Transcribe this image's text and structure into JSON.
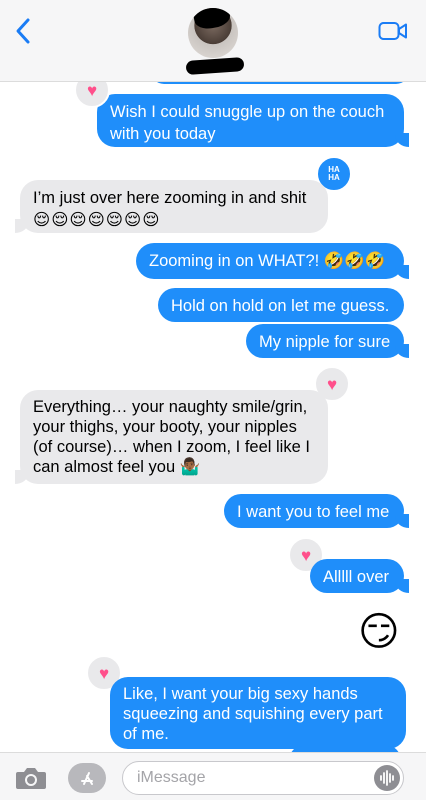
{
  "header": {
    "contact_name": ""
  },
  "messages": [
    {
      "id": "m1",
      "side": "out",
      "text_line1": "Wish I could snuggle up on the couch",
      "text_line2": "with you today",
      "reaction": "heart"
    },
    {
      "id": "m2",
      "side": "in",
      "text_line1": "I’m just over here zooming in and shit",
      "text_line2": "😌😌😌😌😌😌😌",
      "reaction": "haha"
    },
    {
      "id": "m3",
      "side": "out",
      "text": "Zooming in on WHAT?! 🤣🤣🤣"
    },
    {
      "id": "m4",
      "side": "out",
      "text": "Hold on hold on let me guess."
    },
    {
      "id": "m5",
      "side": "out",
      "text": "My nipple for sure",
      "reaction": "heart"
    },
    {
      "id": "m6",
      "side": "in",
      "lines": [
        "Everything… your naughty smile/grin,",
        "your thighs, your booty, your nipples",
        "(of course)… when I zoom, I feel like I",
        "can almost feel you 🤷🏾‍♂️"
      ]
    },
    {
      "id": "m7",
      "side": "out",
      "text": "I want you to feel me",
      "reaction": "heart"
    },
    {
      "id": "m8",
      "side": "out",
      "text": "Alllll over"
    },
    {
      "id": "m9",
      "side": "out",
      "emoji": "😏"
    },
    {
      "id": "m10",
      "side": "out",
      "lines": [
        "Like, I want your big sexy hands",
        "squeezing and squishing every part",
        "of me."
      ],
      "reaction": "heart"
    }
  ],
  "reactions": {
    "heart": "♥",
    "haha_line1": "HA",
    "haha_line2": "HA"
  },
  "composer": {
    "placeholder": "iMessage"
  },
  "icons": {
    "back": "chevron-left-icon",
    "video": "video-camera-icon",
    "camera": "camera-icon",
    "apps": "app-store-icon",
    "audio": "audio-waveform-icon"
  },
  "colors": {
    "outgoing_bubble": "#1f8efa",
    "incoming_bubble": "#e9e9eb",
    "heart": "#ff4f8b",
    "accent": "#1a7cf5"
  }
}
